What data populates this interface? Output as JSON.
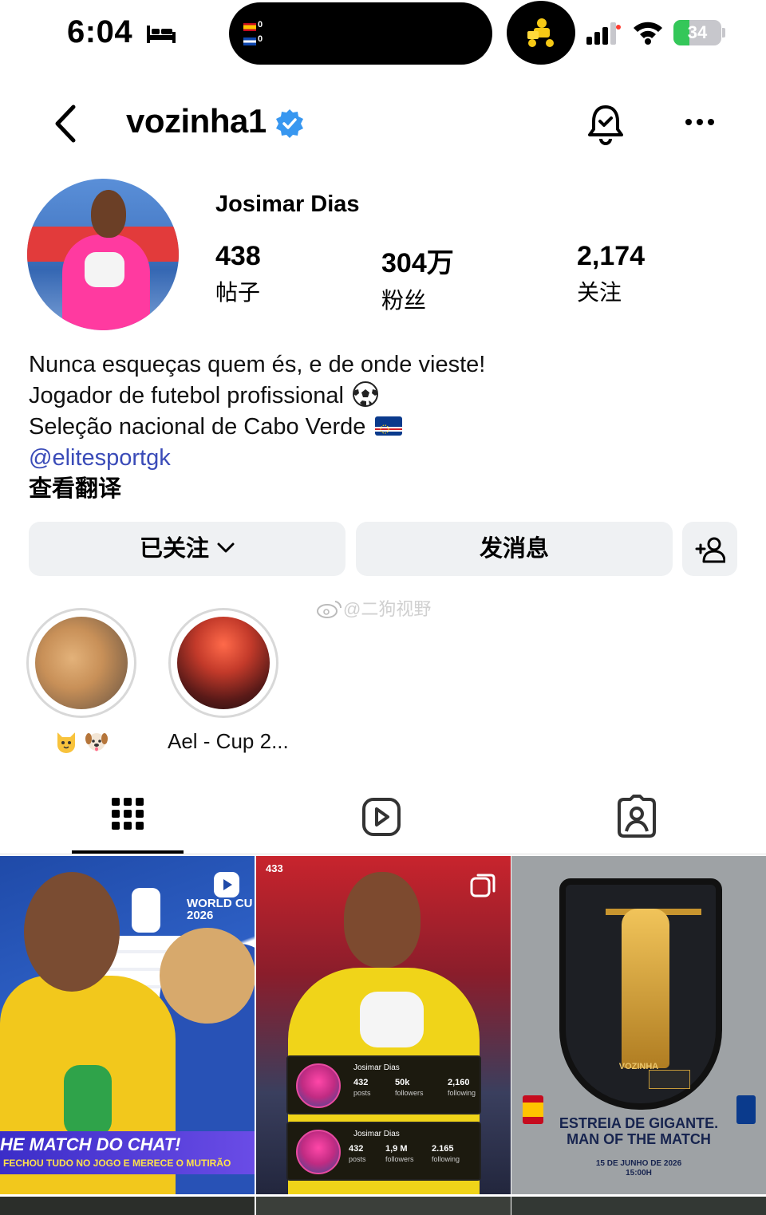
{
  "status_bar": {
    "time": "6:04",
    "battery_text": "34",
    "battery_level": 0.34,
    "match_score_home": "0",
    "match_score_away": "0"
  },
  "header": {
    "username": "vozinha1",
    "verified": true
  },
  "profile": {
    "display_name": "Josimar Dias",
    "stats": [
      {
        "value": "438",
        "label": "帖子"
      },
      {
        "value": "304万",
        "label": "粉丝"
      },
      {
        "value": "2,174",
        "label": "关注"
      }
    ],
    "bio": [
      "Nunca esqueças quem és, e de onde vieste!",
      "Jogador de futebol profissional",
      "Seleção nacional de Cabo Verde"
    ],
    "bio_link": "@elitesportgk",
    "translate_label": "查看翻译"
  },
  "actions": {
    "following_label": "已关注",
    "message_label": "发消息"
  },
  "watermark": "@二狗视野",
  "highlights": [
    {
      "label": "Ael - Cup 2..."
    }
  ],
  "tabs": [
    "posts-grid",
    "reels",
    "tagged"
  ],
  "posts": {
    "post1": {
      "banner_title": "HE MATCH DO CHAT!",
      "banner_sub": "FECHOU TUDO NO JOGO E MERECE O MUTIRÃO",
      "wc_line1": "WORLD CU",
      "wc_line2": "2026"
    },
    "post2": {
      "tag": "433",
      "card1": {
        "name": "Josimar Dias",
        "posts": "432",
        "posts_label": "posts",
        "followers": "50k",
        "followers_label": "followers",
        "following": "2,160",
        "following_label": "following"
      },
      "card2": {
        "name": "Josimar Dias",
        "posts": "432",
        "posts_label": "posts",
        "followers": "1,9 M",
        "followers_label": "followers",
        "following": "2.165",
        "following_label": "following"
      }
    },
    "post3": {
      "plate_name": "VOZINHA",
      "title_line1": "ESTREIA DE GIGANTE.",
      "title_line2": "MAN OF THE MATCH",
      "date_line1": "15 DE JUNHO DE 2026",
      "date_line2": "15:00H"
    }
  },
  "colors": {
    "verified_blue": "#3897f0",
    "link_blue": "#3a4bb8",
    "button_bg": "#eff1f3",
    "battery_green": "#34c759"
  }
}
